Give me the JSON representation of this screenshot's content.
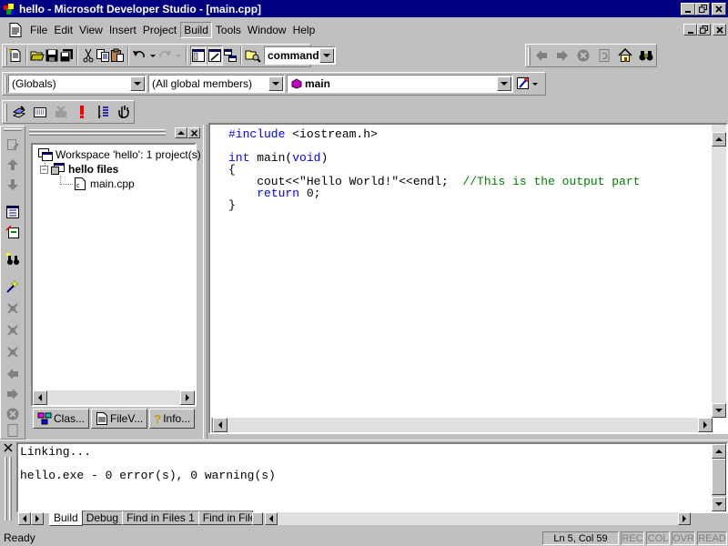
{
  "window": {
    "title": "hello - Microsoft Developer Studio - [main.cpp]",
    "app_icon": "devstudio-icon"
  },
  "menubar": {
    "items": [
      "File",
      "Edit",
      "View",
      "Insert",
      "Project",
      "Build",
      "Tools",
      "Window",
      "Help"
    ],
    "active": "Build"
  },
  "toolbar_standard": {
    "buttons": [
      "workspace-icon",
      "open-icon",
      "save-icon",
      "save-all-icon",
      "cut-icon",
      "copy-icon",
      "paste-icon",
      "undo-icon",
      "redo-icon",
      "workspace-toggle-icon",
      "output-toggle-icon",
      "window-list-icon",
      "find-in-files-icon"
    ],
    "command_combo": "command",
    "nav_buttons": [
      "back-arrow-icon",
      "forward-arrow-icon",
      "stop-icon",
      "refresh-icon",
      "home-icon",
      "binoculars-icon"
    ]
  },
  "wizardbar": {
    "globals": "(Globals)",
    "members": "(All global members)",
    "function": "main"
  },
  "build_toolbar": {
    "buttons": [
      "compile-icon",
      "build-icon",
      "stop-build-icon",
      "execute-icon",
      "go-icon",
      "breakpoint-icon"
    ]
  },
  "workspace": {
    "root": "Workspace 'hello': 1 project(s)",
    "project": "hello files",
    "file": "main.cpp",
    "tabs": [
      "Clas...",
      "FileV...",
      "Info..."
    ]
  },
  "editor": {
    "lines": [
      {
        "parts": [
          {
            "t": "#include",
            "c": "kw"
          },
          {
            "t": " <iostream.h>",
            "c": ""
          }
        ]
      },
      {
        "parts": []
      },
      {
        "parts": [
          {
            "t": "int",
            "c": "kw"
          },
          {
            "t": " main(",
            "c": ""
          },
          {
            "t": "void",
            "c": "kw"
          },
          {
            "t": ")",
            "c": ""
          }
        ]
      },
      {
        "parts": [
          {
            "t": "{",
            "c": ""
          }
        ]
      },
      {
        "parts": [
          {
            "t": "    cout<<\"Hello World!\"<<endl;  ",
            "c": ""
          },
          {
            "t": "//This is the output part",
            "c": "cm"
          }
        ]
      },
      {
        "parts": [
          {
            "t": "    ",
            "c": ""
          },
          {
            "t": "return",
            "c": "kw"
          },
          {
            "t": " 0;",
            "c": ""
          }
        ]
      },
      {
        "parts": [
          {
            "t": "}",
            "c": ""
          }
        ]
      }
    ]
  },
  "output": {
    "lines": [
      "Linking...",
      "",
      "hello.exe - 0 error(s), 0 warning(s)"
    ],
    "tabs": [
      "Build",
      "Debug",
      "Find in Files 1",
      "Find in Files"
    ],
    "active_tab": "Build"
  },
  "statusbar": {
    "message": "Ready",
    "position": "Ln 5, Col 59",
    "indicators": [
      "REC",
      "COL",
      "OVR",
      "READ"
    ]
  }
}
